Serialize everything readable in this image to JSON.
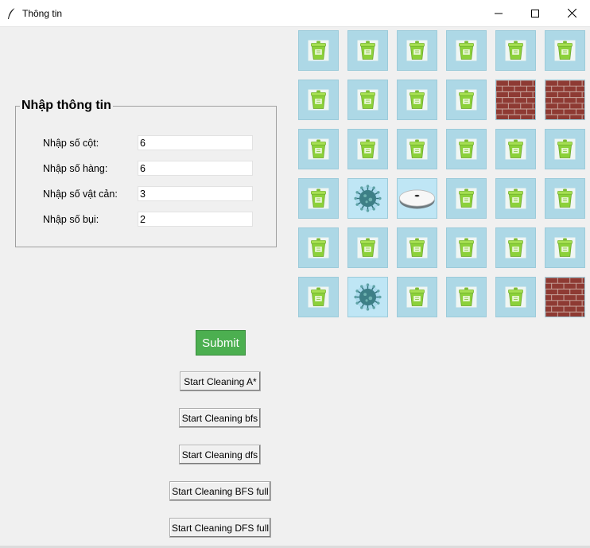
{
  "window": {
    "title": "Thông tin"
  },
  "form": {
    "group_title": "Nhập thông tin",
    "fields": [
      {
        "label": "Nhập số cột:",
        "value": "6"
      },
      {
        "label": "Nhập số hàng:",
        "value": "6"
      },
      {
        "label": "Nhập số vật cản:",
        "value": "3"
      },
      {
        "label": "Nhập số bụi:",
        "value": "2"
      }
    ]
  },
  "buttons": {
    "submit": "Submit",
    "astar": "Start Cleaning A*",
    "bfs": "Start Cleaning bfs",
    "dfs": "Start Cleaning dfs",
    "bfs_full": "Start Cleaning BFS full",
    "dfs_full": "Start Cleaning DFS full"
  },
  "colors": {
    "cell_background": "#add8e6",
    "submit_background": "#4caf50",
    "brick": "#8e3a33"
  },
  "grid": {
    "columns": 6,
    "rows": 6,
    "cells": [
      [
        "trash-bin",
        "trash-bin",
        "trash-bin",
        "trash-bin",
        "trash-bin",
        "trash-bin"
      ],
      [
        "trash-bin",
        "trash-bin",
        "trash-bin",
        "trash-bin",
        "brick-wall",
        "brick-wall"
      ],
      [
        "trash-bin",
        "trash-bin",
        "trash-bin",
        "trash-bin",
        "trash-bin",
        "trash-bin"
      ],
      [
        "trash-bin",
        "virus-dust",
        "robot-vacuum",
        "trash-bin",
        "trash-bin",
        "trash-bin"
      ],
      [
        "trash-bin",
        "trash-bin",
        "trash-bin",
        "trash-bin",
        "trash-bin",
        "trash-bin"
      ],
      [
        "trash-bin",
        "virus-dust",
        "trash-bin",
        "trash-bin",
        "trash-bin",
        "brick-wall"
      ]
    ]
  }
}
